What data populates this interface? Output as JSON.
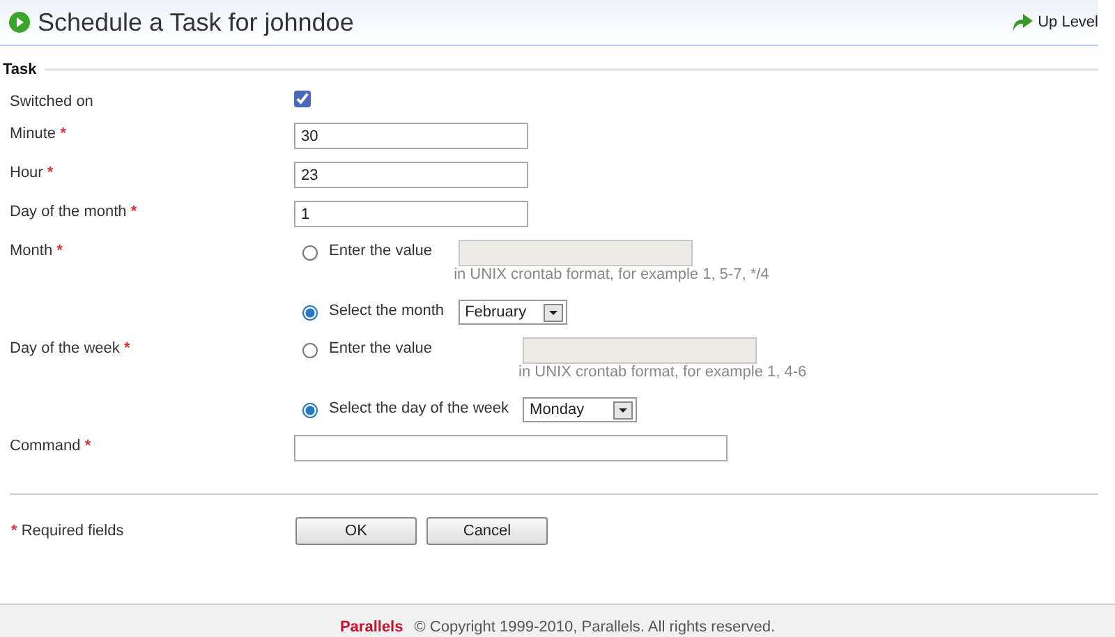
{
  "header": {
    "title": "Schedule a Task for johndoe",
    "up_level": "Up Level"
  },
  "section": {
    "title": "Task"
  },
  "required_mark": "*",
  "fields": [
    {
      "kind": "checkbox",
      "label": "Switched on",
      "required": false,
      "checked": true
    },
    {
      "kind": "text",
      "label": "Minute",
      "required": true,
      "value": "30"
    },
    {
      "kind": "text",
      "label": "Hour",
      "required": true,
      "value": "23"
    },
    {
      "kind": "text",
      "label": "Day of the month",
      "required": true,
      "value": "1"
    },
    {
      "kind": "choice",
      "label": "Month",
      "required": true,
      "options": [
        {
          "kind": "entry",
          "label": "Enter the value",
          "selected": false,
          "hint": "in UNIX crontab format, for example 1, 5-7, */4"
        },
        {
          "kind": "select",
          "label": "Select the month",
          "selected": true,
          "value": "February"
        }
      ]
    },
    {
      "kind": "choice",
      "label": "Day of the week",
      "required": true,
      "options": [
        {
          "kind": "entry",
          "label": "Enter the value",
          "selected": false,
          "hint": "in UNIX crontab format, for example 1, 4-6"
        },
        {
          "kind": "select",
          "label": "Select the day of the week",
          "selected": true,
          "value": "Monday"
        }
      ]
    },
    {
      "kind": "wide",
      "label": "Command",
      "required": true
    }
  ],
  "required_note": "Required fields",
  "buttons": [
    "OK",
    "Cancel"
  ],
  "footer": {
    "brand": "Parallels",
    "copyright": "© Copyright 1999-2010, Parallels. All rights reserved."
  }
}
